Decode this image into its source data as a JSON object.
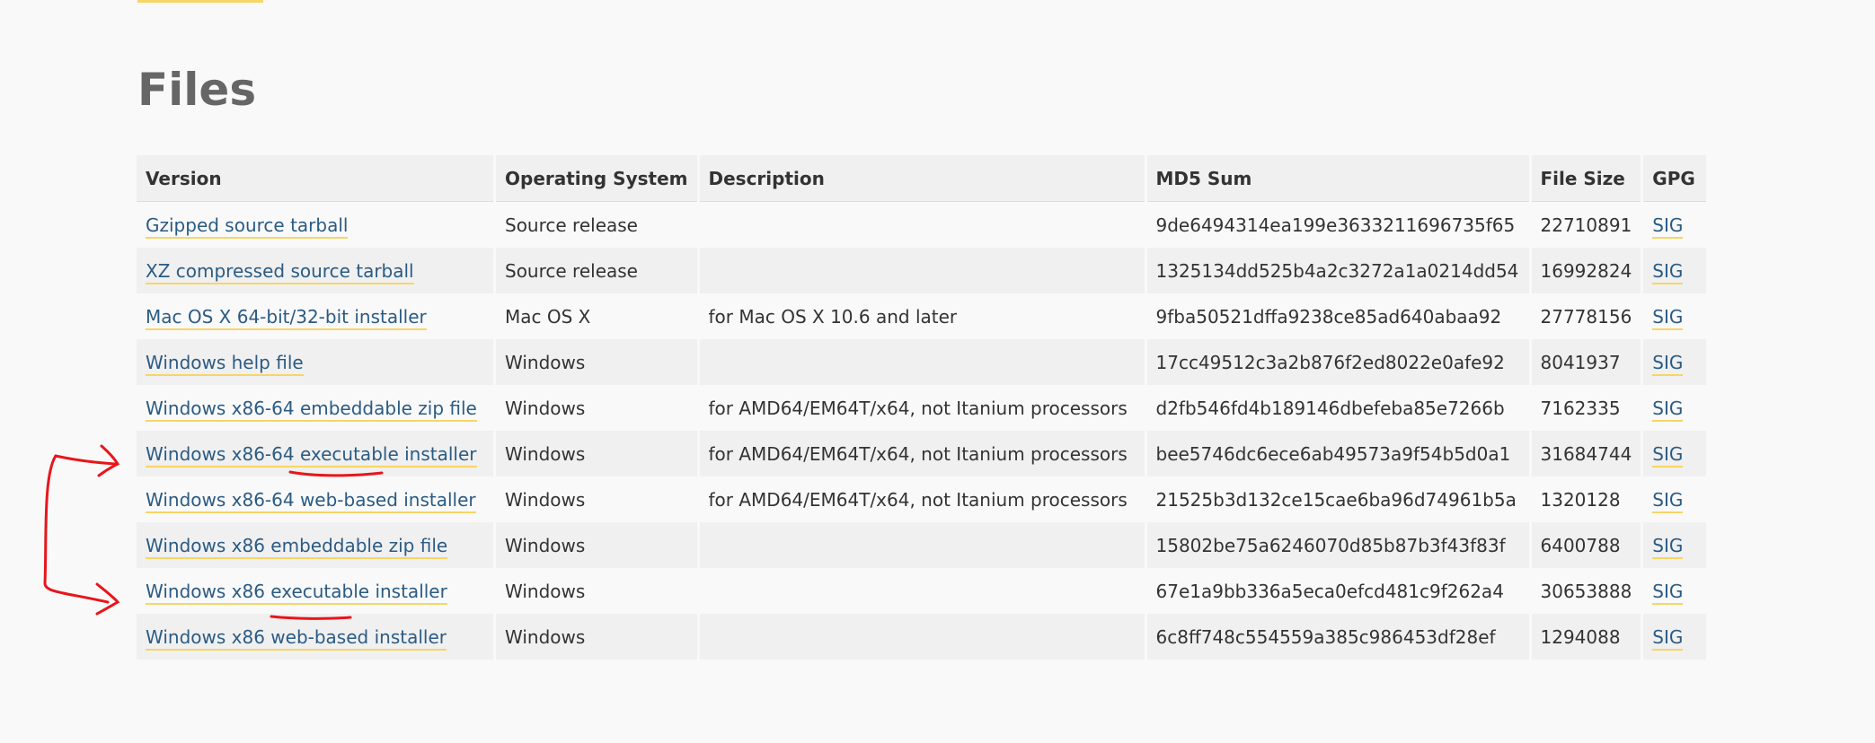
{
  "page": {
    "title": "Files"
  },
  "table": {
    "headers": {
      "version": "Version",
      "os": "Operating System",
      "description": "Description",
      "md5": "MD5 Sum",
      "size": "File Size",
      "gpg": "GPG"
    },
    "rows": [
      {
        "version": "Gzipped source tarball",
        "os": "Source release",
        "description": "",
        "md5": "9de6494314ea199e3633211696735f65",
        "size": "22710891",
        "gpg": "SIG"
      },
      {
        "version": "XZ compressed source tarball",
        "os": "Source release",
        "description": "",
        "md5": "1325134dd525b4a2c3272a1a0214dd54",
        "size": "16992824",
        "gpg": "SIG"
      },
      {
        "version": "Mac OS X 64-bit/32-bit installer",
        "os": "Mac OS X",
        "description": "for Mac OS X 10.6 and later",
        "md5": "9fba50521dffa9238ce85ad640abaa92",
        "size": "27778156",
        "gpg": "SIG"
      },
      {
        "version": "Windows help file",
        "os": "Windows",
        "description": "",
        "md5": "17cc49512c3a2b876f2ed8022e0afe92",
        "size": "8041937",
        "gpg": "SIG"
      },
      {
        "version": "Windows x86-64 embeddable zip file",
        "os": "Windows",
        "description": "for AMD64/EM64T/x64, not Itanium processors",
        "md5": "d2fb546fd4b189146dbefeba85e7266b",
        "size": "7162335",
        "gpg": "SIG"
      },
      {
        "version": "Windows x86-64 executable installer",
        "os": "Windows",
        "description": "for AMD64/EM64T/x64, not Itanium processors",
        "md5": "bee5746dc6ece6ab49573a9f54b5d0a1",
        "size": "31684744",
        "gpg": "SIG"
      },
      {
        "version": "Windows x86-64 web-based installer",
        "os": "Windows",
        "description": "for AMD64/EM64T/x64, not Itanium processors",
        "md5": "21525b3d132ce15cae6ba96d74961b5a",
        "size": "1320128",
        "gpg": "SIG"
      },
      {
        "version": "Windows x86 embeddable zip file",
        "os": "Windows",
        "description": "",
        "md5": "15802be75a6246070d85b87b3f43f83f",
        "size": "6400788",
        "gpg": "SIG"
      },
      {
        "version": "Windows x86 executable installer",
        "os": "Windows",
        "description": "",
        "md5": "67e1a9bb336a5eca0efcd481c9f262a4",
        "size": "30653888",
        "gpg": "SIG"
      },
      {
        "version": "Windows x86 web-based installer",
        "os": "Windows",
        "description": "",
        "md5": "6c8ff748c554559a385c986453df28ef",
        "size": "1294088",
        "gpg": "SIG"
      }
    ]
  },
  "colors": {
    "link": "#2b5b84",
    "link_underline": "#f7d566",
    "annotation": "#e8151b",
    "row_alt": "#f0f0f0"
  }
}
